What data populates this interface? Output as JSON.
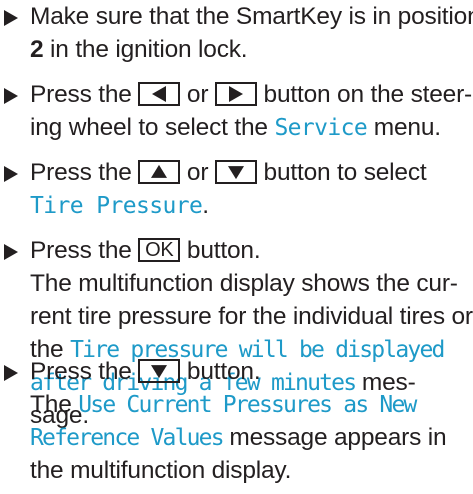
{
  "colors": {
    "text": "#231f20",
    "display_text": "#1e9ac8"
  },
  "steps": [
    {
      "icon": "arrow-bullet-icon",
      "line1": "Make sure that the SmartKey is in position",
      "line2_bold": "2",
      "line2_rest": " in the ignition lock."
    },
    {
      "icon": "arrow-bullet-icon",
      "line1_a": "Press the",
      "line1_b": "or",
      "line1_c": "button on the steer-",
      "line2_a": "ing wheel to select the ",
      "line2_disp": "Service",
      "line2_b": " menu."
    },
    {
      "icon": "arrow-bullet-icon",
      "line1_a": "Press the",
      "line1_b": "or",
      "line1_c": "button to select",
      "line2_disp": "Tire Pressure",
      "line2_b": "."
    },
    {
      "icon": "arrow-bullet-icon",
      "line1_a": "Press the",
      "key_label": "OK",
      "line1_b": "button.",
      "line2": "The multifunction display shows the cur-",
      "line3": "rent tire pressure for the individual tires or",
      "line4_a": "the ",
      "line4_disp": "Tire pressure will be displayed",
      "line5_disp": "after driving a few minutes",
      "line5_b": " mes-",
      "line6": "sage."
    },
    {
      "icon": "arrow-bullet-icon",
      "line1_a": "Press the",
      "line1_b": "button.",
      "line2_a": "The ",
      "line2_disp": "Use Current Pressures as New",
      "line3_disp": "Reference Values",
      "line3_b": " message appears in",
      "line4": "the multifunction display."
    }
  ]
}
